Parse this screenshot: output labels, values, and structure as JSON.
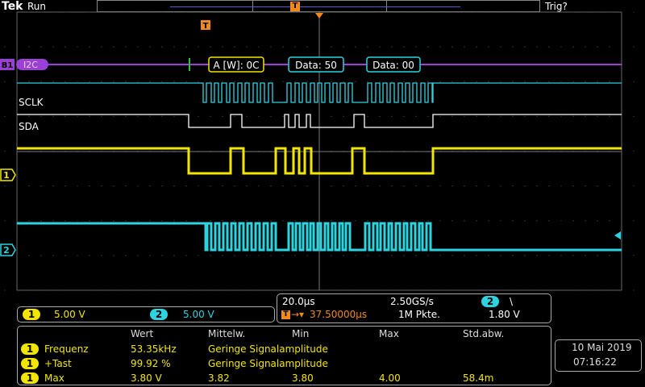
{
  "header": {
    "brand": "Tek",
    "run_state": "Run",
    "trigger_status": "Trig?",
    "trigger_marker": "T"
  },
  "bus": {
    "badge": "B1",
    "protocol": "I2C",
    "packets": [
      "A [W]: 0C",
      "Data: 50",
      "Data: 00"
    ]
  },
  "digital": {
    "clk_label": "SCLK",
    "data_label": "SDA"
  },
  "channels": [
    {
      "num": "1",
      "color": "#f2e600",
      "scale": "5.00 V"
    },
    {
      "num": "2",
      "color": "#2ed3e0",
      "scale": "5.00 V"
    }
  ],
  "acquisition": {
    "timebase": "20.0µs",
    "sample_rate": "2.50GS/s",
    "trigger_channel": "2",
    "trigger_slope": "\\",
    "trigger_position": "37.50000µs",
    "record_length": "1M Pkte.",
    "trigger_level": "1.80 V"
  },
  "measurements": {
    "headers": [
      "Wert",
      "Mittelw.",
      "Min",
      "Max",
      "Std.abw."
    ],
    "rows": [
      {
        "ch": "1",
        "name": "Frequenz",
        "wert": "53.35kHz",
        "mittelw": "Geringe Signalamplitude",
        "min": "",
        "max": "",
        "std": ""
      },
      {
        "ch": "1",
        "name": "+Tast",
        "wert": "99.92 %",
        "mittelw": "Geringe Signalamplitude",
        "min": "",
        "max": "",
        "std": ""
      },
      {
        "ch": "1",
        "name": "Max",
        "wert": "3.80 V",
        "mittelw": "3.82",
        "min": "3.80",
        "max": "4.00",
        "std": "58.4m"
      }
    ]
  },
  "clock": {
    "date": "10 Mai  2019",
    "time": "07:16:22"
  },
  "colors": {
    "ch1": "#f2e600",
    "ch2": "#2ed3e0",
    "bus": "#9b3fd6",
    "trigger": "#f08a1c",
    "grid": "#555555"
  }
}
